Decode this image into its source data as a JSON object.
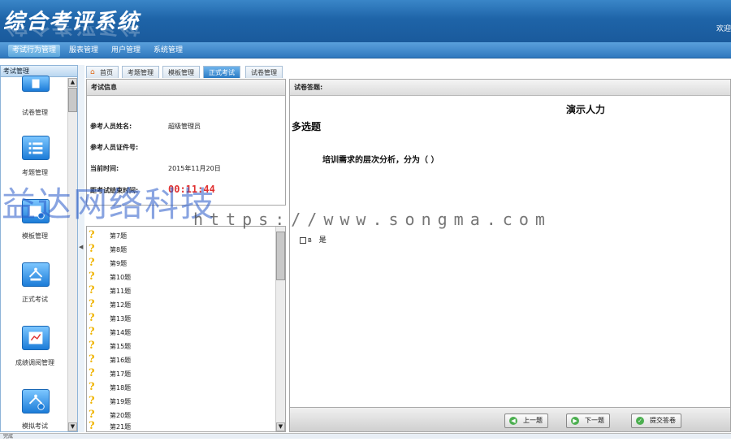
{
  "app": {
    "title": "综合考评系统",
    "welcome": "欢迎"
  },
  "menu": [
    {
      "label": "考试行为管理",
      "active": true
    },
    {
      "label": "服表管理",
      "active": false
    },
    {
      "label": "用户管理",
      "active": false
    },
    {
      "label": "系统管理",
      "active": false
    }
  ],
  "sidebar": {
    "header": "考试管理",
    "items": [
      {
        "label": "试卷管理",
        "icon": "document-icon"
      },
      {
        "label": "考题管理",
        "icon": "list-icon"
      },
      {
        "label": "模板管理",
        "icon": "template-icon"
      },
      {
        "label": "正式考试",
        "icon": "exam-icon"
      },
      {
        "label": "成绩调阅管理",
        "icon": "score-icon"
      },
      {
        "label": "模拟考试",
        "icon": "mock-exam-icon"
      }
    ]
  },
  "tabs": [
    {
      "label": "首页",
      "active": false
    },
    {
      "label": "考题管理",
      "active": false
    },
    {
      "label": "模板管理",
      "active": false
    },
    {
      "label": "正式考试",
      "active": true
    },
    {
      "label": "试卷管理",
      "active": false
    }
  ],
  "exam_info": {
    "header": "考试信息",
    "name_label": "参考人员姓名:",
    "name_value": "超级管理员",
    "id_label": "参考人员证件号:",
    "id_value": "",
    "time_label": "当前时间:",
    "time_value": "2015年11月20日",
    "remaining_label": "距考试结束时间:",
    "remaining_value": "00:11:44"
  },
  "question_list": [
    "第7题",
    "第8题",
    "第9题",
    "第10题",
    "第11题",
    "第12题",
    "第13题",
    "第14题",
    "第15题",
    "第16题",
    "第17题",
    "第18题",
    "第19题",
    "第20题",
    "第21题"
  ],
  "paper": {
    "header": "试卷答题:",
    "title": "演示人力",
    "question_type": "多选题",
    "question_text": "培训需求的层次分析，分为（   ）",
    "option_text": "是",
    "option_prefix": "B"
  },
  "buttons": {
    "prev": "上一题",
    "next": "下一题",
    "submit": "提交答卷"
  },
  "watermark": {
    "cn": "益达网络科技",
    "url": "https://www.songma.com"
  },
  "status": "完成",
  "colors": {
    "header": "#1e64a8",
    "accent": "#2b7cc5",
    "timer": "#e03030",
    "question_mark": "#f0b400"
  }
}
